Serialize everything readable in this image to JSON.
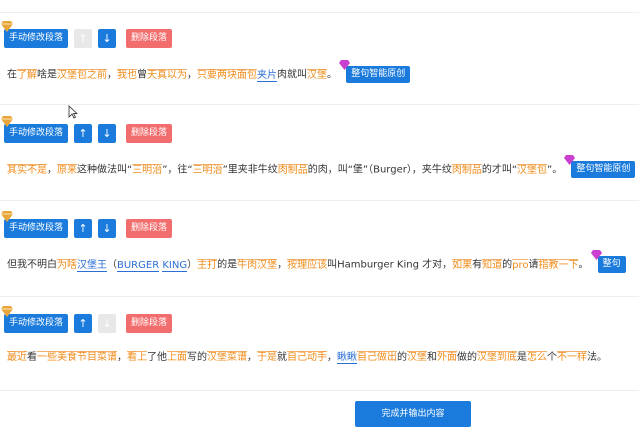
{
  "blocks": [
    {
      "manual_label": "手动修改段落",
      "up_icon": "arrow-up-icon",
      "down_icon": "arrow-down-icon",
      "delete_label": "删除段落",
      "up_disabled": true,
      "down_disabled": false,
      "segments": [
        "在",
        "了解",
        "啥是",
        "汉堡包之前",
        "，",
        "我也",
        "曾",
        "天真",
        "以为",
        "，",
        "只要",
        "两块",
        "面包",
        "夹片",
        "肉就叫",
        "汉堡",
        "。"
      ],
      "smart_label": "整句智能原创"
    },
    {
      "manual_label": "手动修改段落",
      "up_icon": "arrow-up-icon",
      "down_icon": "arrow-down-icon",
      "delete_label": "删除段落",
      "up_disabled": false,
      "down_disabled": false,
      "segments": [
        "其实",
        "不是",
        "，",
        "原来",
        "这种做法叫“",
        "三明治",
        "”，往“",
        "三明治",
        "”里夹非牛纹",
        "肉制品",
        "的肉，叫“堡”（Burger），夹牛纹",
        "肉制品",
        "的才叫“",
        "汉堡包",
        "”。"
      ],
      "smart_label": "整句智能原创"
    },
    {
      "manual_label": "手动修改段落",
      "up_icon": "arrow-up-icon",
      "down_icon": "arrow-down-icon",
      "delete_label": "删除段落",
      "up_disabled": false,
      "down_disabled": false,
      "segments": [
        "但我不明白",
        "为啥",
        "汉堡王",
        "（",
        "BURGER",
        "KING",
        "）",
        "主打",
        "的是",
        "牛肉汉堡",
        "，",
        "按理",
        "应该",
        "叫Hamburger King 才对，",
        "如果",
        "有",
        "知道",
        "的",
        "pro",
        "请",
        "指教",
        "一下",
        "。"
      ],
      "smart_label": "整句"
    },
    {
      "manual_label": "手动修改段落",
      "up_icon": "arrow-up-icon",
      "down_icon": "arrow-down-icon",
      "delete_label": "删除段落",
      "up_disabled": false,
      "down_disabled": true,
      "segments": [
        "最近",
        "看",
        "一些",
        "美食节目",
        "菜谱",
        "，",
        "看上",
        "了他",
        "上面",
        "写的",
        "汉堡",
        "菜谱",
        "，",
        "于是",
        "就",
        "自己动手",
        "，",
        "瞅瞅",
        "自己",
        "做出",
        "的",
        "汉堡",
        "和",
        "外面",
        "做的",
        "汉堡",
        "到底",
        "是",
        "怎么",
        "个",
        "不一样",
        "法。"
      ],
      "smart_label": ""
    }
  ],
  "finish_label": "完成并输出内容",
  "colors": {
    "primary": "#1b7bdc",
    "danger": "#f26d6d",
    "highlight_orange": "#f08c1a",
    "highlight_blue": "#2c6fd6",
    "gem_gold": "#e8a63a",
    "gem_pink": "#c93fd0"
  }
}
